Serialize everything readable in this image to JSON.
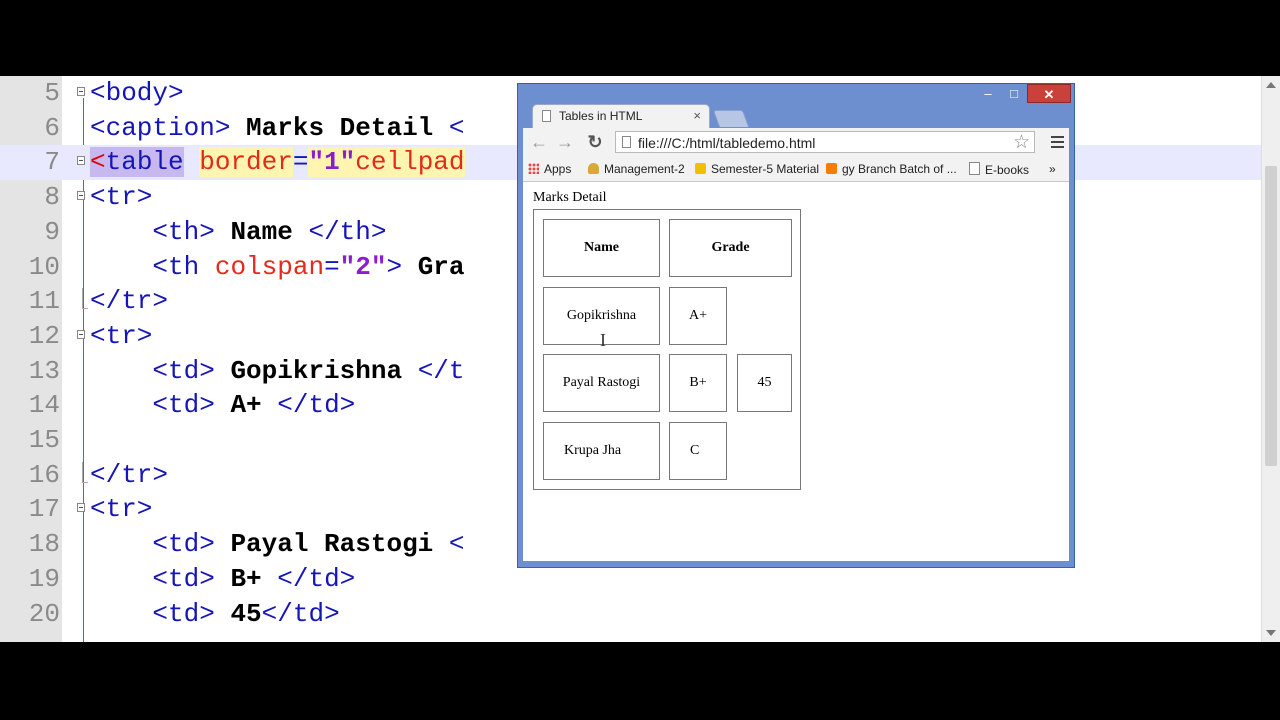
{
  "editor": {
    "lines": [
      {
        "n": "5",
        "tokens": [
          [
            "tg",
            "<body>"
          ]
        ]
      },
      {
        "n": "6",
        "tokens": [
          [
            "tg",
            "<caption>"
          ],
          [
            "tx",
            " Marks Detail "
          ],
          [
            "tg",
            "<"
          ]
        ]
      },
      {
        "n": "7",
        "tokens": [
          [
            "sel-hl",
            "<"
          ],
          [
            "sel-tg",
            "table"
          ],
          [
            "sp",
            " "
          ],
          [
            "at-hl",
            "border"
          ],
          [
            "tg",
            "="
          ],
          [
            "av-hl",
            "\"1\""
          ],
          [
            "at-hl",
            "cellpad"
          ]
        ]
      },
      {
        "n": "8",
        "tokens": [
          [
            "tg",
            "<tr>"
          ]
        ]
      },
      {
        "n": "9",
        "tokens": [
          [
            "sp",
            "    "
          ],
          [
            "tg",
            "<th>"
          ],
          [
            "tx",
            " Name "
          ],
          [
            "tg",
            "</th>"
          ]
        ]
      },
      {
        "n": "10",
        "tokens": [
          [
            "sp",
            "    "
          ],
          [
            "tg",
            "<th "
          ],
          [
            "at",
            "colspan"
          ],
          [
            "tg",
            "="
          ],
          [
            "av",
            "\"2\""
          ],
          [
            "tg",
            ">"
          ],
          [
            "tx",
            " Gra"
          ]
        ]
      },
      {
        "n": "11",
        "tokens": [
          [
            "tg",
            "</tr>"
          ]
        ]
      },
      {
        "n": "12",
        "tokens": [
          [
            "tg",
            "<tr>"
          ]
        ]
      },
      {
        "n": "13",
        "tokens": [
          [
            "sp",
            "    "
          ],
          [
            "tg",
            "<td>"
          ],
          [
            "tx",
            " Gopikrishna "
          ],
          [
            "tg",
            "</t"
          ]
        ]
      },
      {
        "n": "14",
        "tokens": [
          [
            "sp",
            "    "
          ],
          [
            "tg",
            "<td>"
          ],
          [
            "tx",
            " A+ "
          ],
          [
            "tg",
            "</td>"
          ]
        ]
      },
      {
        "n": "15",
        "tokens": []
      },
      {
        "n": "16",
        "tokens": [
          [
            "tg",
            "</tr>"
          ]
        ]
      },
      {
        "n": "17",
        "tokens": [
          [
            "tg",
            "<tr>"
          ]
        ]
      },
      {
        "n": "18",
        "tokens": [
          [
            "sp",
            "    "
          ],
          [
            "tg",
            "<td>"
          ],
          [
            "tx",
            " Payal Rastogi "
          ],
          [
            "tg",
            "<"
          ]
        ]
      },
      {
        "n": "19",
        "tokens": [
          [
            "sp",
            "    "
          ],
          [
            "tg",
            "<td>"
          ],
          [
            "tx",
            " B+ "
          ],
          [
            "tg",
            "</td>"
          ]
        ]
      },
      {
        "n": "20",
        "tokens": [
          [
            "sp",
            "    "
          ],
          [
            "tg",
            "<td>"
          ],
          [
            "tx",
            " 45"
          ],
          [
            "tg",
            "</td>"
          ]
        ]
      }
    ]
  },
  "browser": {
    "tab_title": "Tables in HTML",
    "tab_close": "×",
    "url": "file:///C:/html/tabledemo.html",
    "win_min": "–",
    "win_max": "□",
    "win_close": "✕",
    "back": "←",
    "forward": "→",
    "reload": "↻",
    "star": "☆",
    "bookmarks": {
      "apps": "Apps",
      "management": "Management-2",
      "semester": "Semester-5 Material",
      "branch": "gy Branch Batch of ...",
      "ebooks": "E-books",
      "more": "»"
    },
    "colors": {
      "frame": "#6d8fd0",
      "close": "#c9413a"
    }
  },
  "page": {
    "caption": "Marks Detail",
    "header": {
      "name": "Name",
      "grade": "Grade"
    },
    "rows": [
      {
        "name": "Gopikrishna",
        "grade": "A+",
        "extra": ""
      },
      {
        "name": "Payal Rastogi",
        "grade": "B+",
        "extra": "45"
      },
      {
        "name": "Krupa Jha",
        "grade": "C",
        "extra": ""
      }
    ]
  },
  "cursor": "I"
}
